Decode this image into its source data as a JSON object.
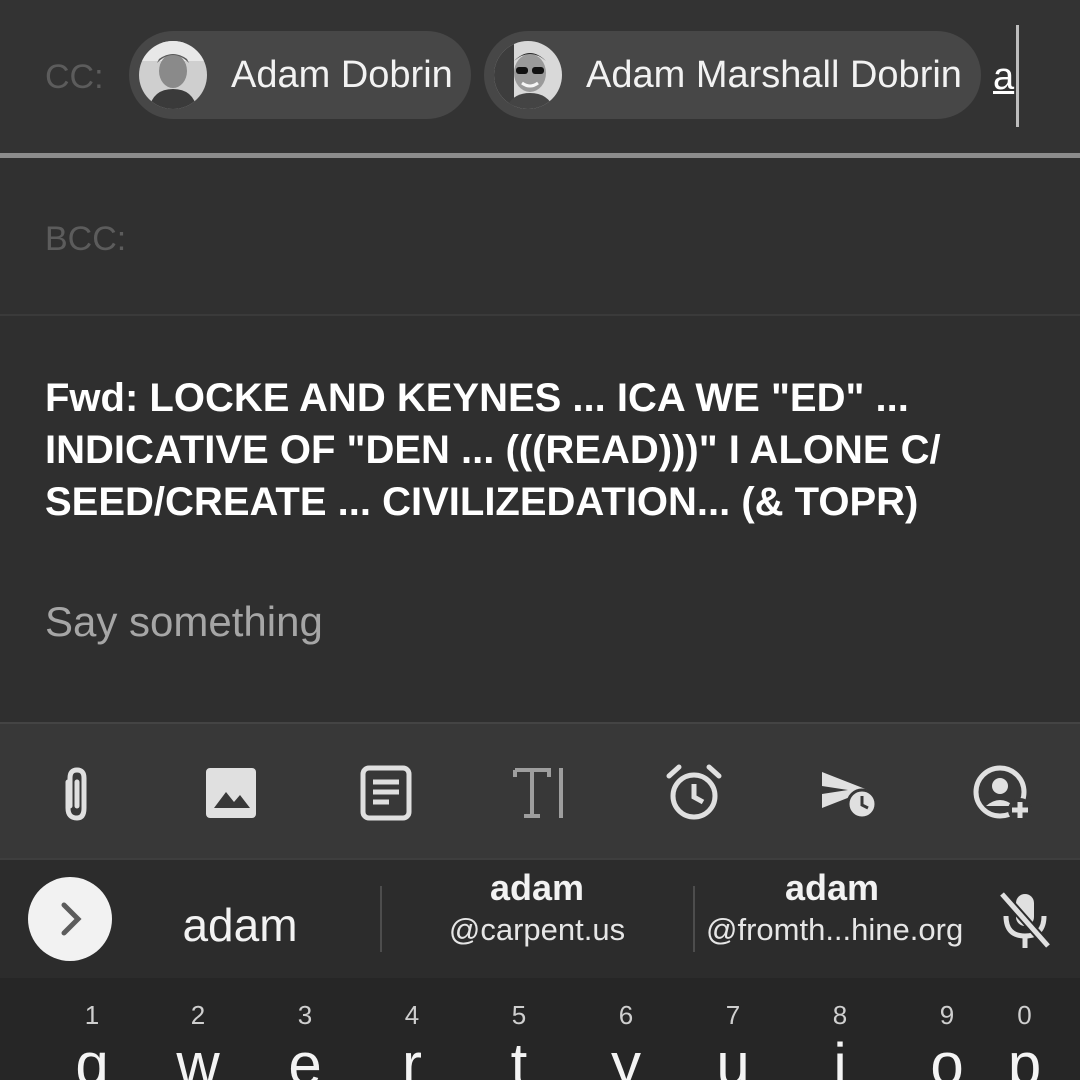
{
  "recipients": {
    "cc_label": "CC:",
    "cc_chips": [
      {
        "name": "Adam Dobrin"
      },
      {
        "name": "Adam Marshall Dobrin"
      }
    ],
    "cc_input_value": "a",
    "bcc_label": "BCC:"
  },
  "subject": "Fwd: LOCKE AND KEYNES ... ICA WE \"ED\" ... INDICATIVE OF \"DEN ... (((READ)))\"  I ALONE C/ SEED/CREATE ... CIVILIZEDATION... (& TOPR)",
  "body_placeholder": "Say something",
  "toolbar": {
    "icons": [
      "paperclip-icon",
      "image-icon",
      "template-icon",
      "text-format-icon",
      "alarm-icon",
      "schedule-send-icon",
      "add-contact-icon"
    ]
  },
  "suggestions": {
    "main": "adam",
    "items": [
      {
        "top": "adam",
        "bottom": "@carpent.us"
      },
      {
        "top": "adam",
        "bottom": "@fromth...hine.org"
      }
    ]
  },
  "keyboard": {
    "numbers": [
      "1",
      "2",
      "3",
      "4",
      "5",
      "6",
      "7",
      "8",
      "9",
      "0"
    ],
    "letters": [
      "q",
      "w",
      "e",
      "r",
      "t",
      "y",
      "u",
      "i",
      "o",
      "p"
    ]
  },
  "colors": {
    "background": "#2f2f2f",
    "chip": "#474747",
    "label_muted": "#5c5c5c",
    "placeholder": "#a6a6a6"
  }
}
